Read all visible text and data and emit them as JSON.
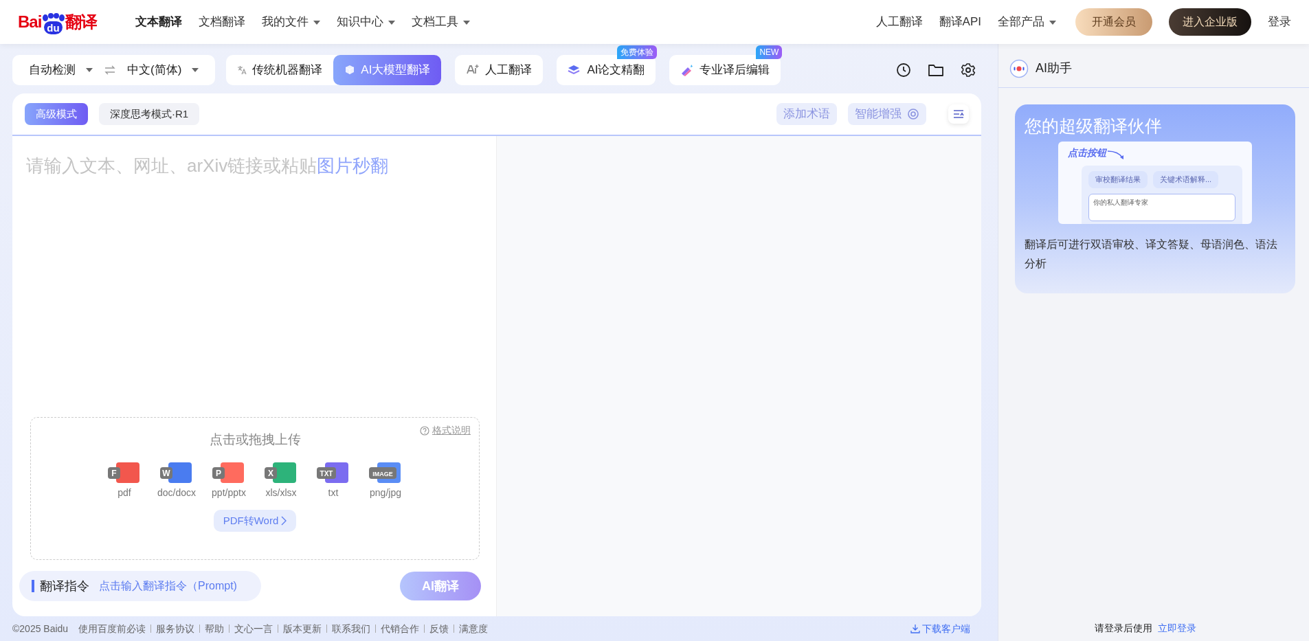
{
  "nav": {
    "logo": {
      "left": "Bai",
      "mark": "du",
      "right": "翻译"
    },
    "links": [
      {
        "label": "文本翻译",
        "selected": true,
        "dropdown": false
      },
      {
        "label": "文档翻译",
        "selected": false,
        "dropdown": false
      },
      {
        "label": "我的文件",
        "selected": false,
        "dropdown": true
      },
      {
        "label": "知识中心",
        "selected": false,
        "dropdown": true
      },
      {
        "label": "文档工具",
        "selected": false,
        "dropdown": true
      }
    ],
    "right_links": [
      {
        "label": "人工翻译",
        "dropdown": false
      },
      {
        "label": "翻译API",
        "dropdown": false
      },
      {
        "label": "全部产品",
        "dropdown": true
      }
    ],
    "vip_button": "开通会员",
    "enterprise_button": "进入企业版",
    "login": "登录"
  },
  "toolbar": {
    "source_lang": "自动检测",
    "target_lang": "中文(简体)",
    "modes": [
      {
        "label": "传统机器翻译",
        "selected": false
      },
      {
        "label": "AI大模型翻译",
        "selected": true
      }
    ],
    "features": [
      {
        "label": "人工翻译"
      },
      {
        "label": "AI论文精翻",
        "badge": "免费体验"
      },
      {
        "label": "专业译后编辑",
        "badge": "NEW"
      }
    ]
  },
  "editor": {
    "modes": [
      {
        "label": "高级模式",
        "selected": true
      },
      {
        "label": "深度思考模式·R1",
        "selected": false
      }
    ],
    "add_term": "添加术语",
    "enhance": "智能增强",
    "placeholder_text": "请输入文本、网址、arXiv链接或粘贴",
    "placeholder_link": "图片秒翻",
    "upload": {
      "title": "点击或拖拽上传",
      "help": "格式说明",
      "formats": [
        {
          "label": "pdf",
          "glyph": "F",
          "color": "#f2574d"
        },
        {
          "label": "doc/docx",
          "glyph": "W",
          "color": "#4a7cf0"
        },
        {
          "label": "ppt/pptx",
          "glyph": "P",
          "color": "#ff6b5e"
        },
        {
          "label": "xls/xlsx",
          "glyph": "X",
          "color": "#2db37a"
        },
        {
          "label": "txt",
          "glyph": "TXT",
          "color": "#7b6cf0"
        },
        {
          "label": "png/jpg",
          "glyph": "IMAGE",
          "color": "#5a8df5"
        }
      ],
      "convert_button": "PDF转Word"
    },
    "prompt": {
      "label": "翻译指令",
      "placeholder": "点击输入翻译指令（Prompt)"
    },
    "translate_button": "AI翻译"
  },
  "footer": {
    "copyright": "©2025 Baidu",
    "links": [
      "使用百度前必读",
      "服务协议",
      "帮助",
      "文心一言",
      "版本更新",
      "联系我们",
      "代销合作",
      "反馈",
      "满意度"
    ],
    "download": "下载客户端"
  },
  "assistant": {
    "title": "AI助手",
    "card": {
      "title": "您的超级翻译伙伴",
      "illustration": {
        "caption": "点击按钮",
        "chips": [
          "审校翻译结果",
          "关键术语解释..."
        ],
        "input": "你的私人翻译专家"
      },
      "description": "翻译后可进行双语审校、译文答疑、母语润色、语法分析"
    },
    "login_hint": "请登录后使用",
    "login_link": "立即登录"
  }
}
